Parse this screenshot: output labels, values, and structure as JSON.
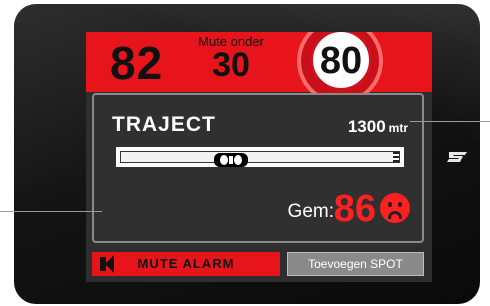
{
  "speed": {
    "current": "82"
  },
  "mute_under": {
    "label": "Mute onder",
    "value": "30"
  },
  "speed_limit": {
    "value": "80"
  },
  "section": {
    "label": "TRAJECT",
    "distance_value": "1300",
    "distance_unit": "mtr",
    "progress_fraction": 0.38
  },
  "average": {
    "label": "Gem:",
    "value": "86",
    "status_icon": "sad-face-icon"
  },
  "buttons": {
    "mute_alarm": "MUTE ALARM",
    "add_spot": "Toevoegen SPOT"
  },
  "colors": {
    "alert_red": "#e8141b",
    "value_red": "#ff2020",
    "screen_bg": "#2e2e2e",
    "button_gray": "#8a8a8a"
  }
}
